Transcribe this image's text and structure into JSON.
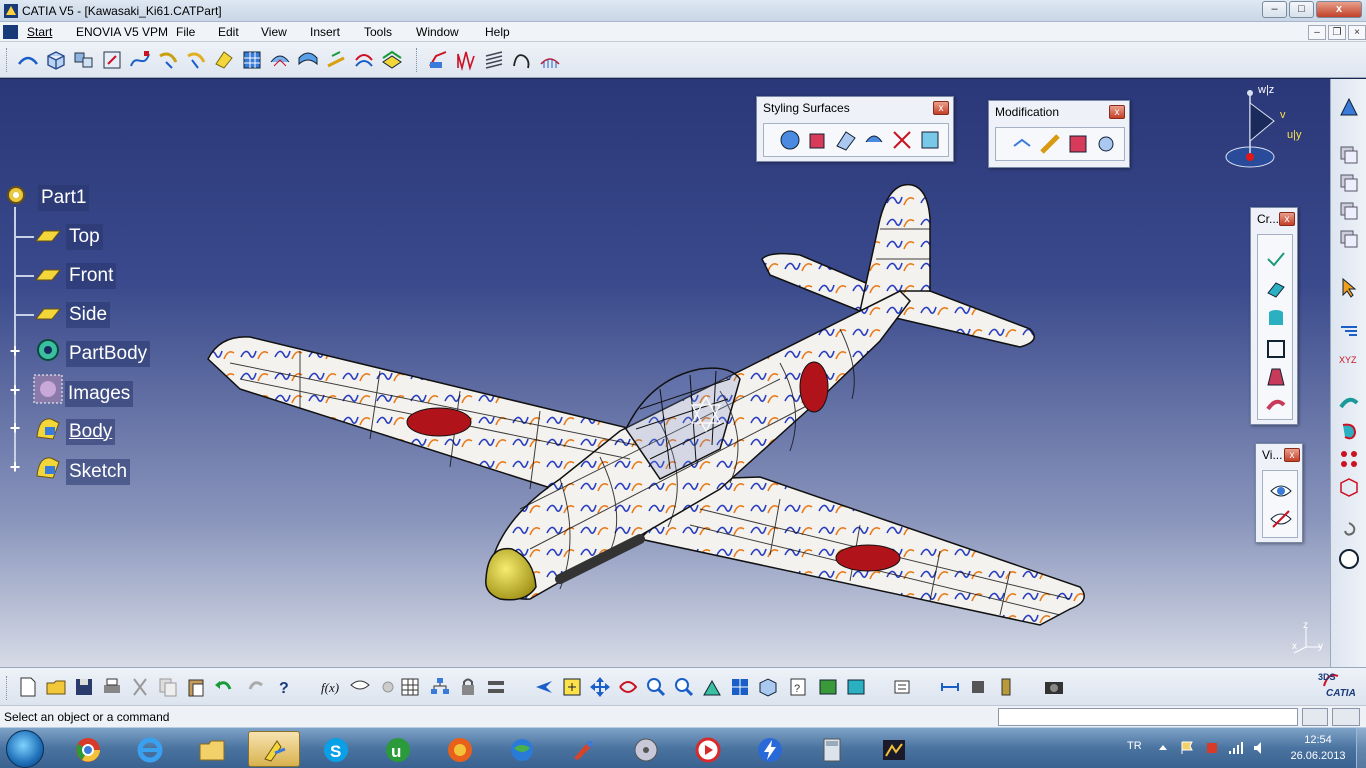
{
  "window": {
    "title": "CATIA V5 - [Kawasaki_Ki61.CATPart]",
    "min": "–",
    "max": "□",
    "close": "x"
  },
  "menu": {
    "items": [
      "Start",
      "ENOVIA V5 VPM",
      "File",
      "Edit",
      "View",
      "Insert",
      "Tools",
      "Window",
      "Help"
    ]
  },
  "palettes": {
    "styling_surfaces": {
      "title": "Styling Surfaces",
      "close": "x"
    },
    "modification": {
      "title": "Modification",
      "close": "x"
    },
    "creation": {
      "title": "Cr...",
      "close": "x"
    },
    "view": {
      "title": "Vi...",
      "close": "x"
    }
  },
  "compass": {
    "w": "w|z",
    "v": "v",
    "u": "u|y"
  },
  "axis_triad": {
    "z": "z",
    "x": "x",
    "y": "y"
  },
  "tree": {
    "items": [
      {
        "label": "Part1",
        "icon": "part-icon"
      },
      {
        "label": "Top",
        "icon": "plane-icon"
      },
      {
        "label": "Front",
        "icon": "plane-icon"
      },
      {
        "label": "Side",
        "icon": "plane-icon"
      },
      {
        "label": "PartBody",
        "icon": "partbody-icon"
      },
      {
        "label": "Images",
        "icon": "images-icon"
      },
      {
        "label": "Body",
        "icon": "body-icon"
      },
      {
        "label": "Sketch",
        "icon": "sketch-icon"
      }
    ]
  },
  "status": {
    "message": "Select an object or a command",
    "command_input": ""
  },
  "taskbar": {
    "apps": [
      "chrome",
      "internet-explorer",
      "file-explorer",
      "catia",
      "skype",
      "utorrent",
      "firefox",
      "network-globe",
      "paint",
      "dvd-player",
      "media-player",
      "thunder",
      "calculator",
      "image-viewer"
    ],
    "language": "TR",
    "time": "12:54",
    "date": "26.06.2013"
  },
  "logo": {
    "text": "CATIA",
    "mark": "3DS"
  },
  "colors": {
    "background_top": "#2a3778",
    "background_bottom": "#d6dbe6",
    "hinomaru": "#b0141a",
    "fuselage": "#f4f2ee",
    "spinner": "#d8c820"
  }
}
